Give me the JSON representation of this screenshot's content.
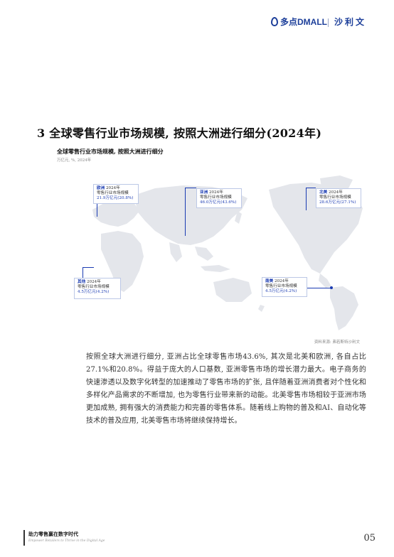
{
  "header": {
    "brand_dmall": "多点DMALL",
    "brand_shaliwen": "沙利文"
  },
  "section": {
    "title": "3  全球零售行业市场规模, 按照大洲进行细分(2024年)"
  },
  "chart": {
    "title": "全球零售行业市场规模, 按照大洲进行细分",
    "unit": "万亿元, %, 2024年",
    "source": "资料来源: 弗若斯特沙利文"
  },
  "chart_data": {
    "type": "map",
    "metric_label": "零售行业市场规模",
    "year": "2024年",
    "regions": [
      {
        "name": "欧洲",
        "value": 21.9,
        "share": 20.8,
        "value_text": "21.9万亿元(20.8%)"
      },
      {
        "name": "亚洲",
        "value": 46.0,
        "share": 43.6,
        "value_text": "46.0万亿元(43.6%)"
      },
      {
        "name": "北美",
        "value": 28.6,
        "share": 27.1,
        "value_text": "28.6万亿元(27.1%)"
      },
      {
        "name": "南美",
        "value": 4.5,
        "share": 4.2,
        "value_text": "4.5万亿元(4.2%)"
      },
      {
        "name": "其他",
        "value": 4.5,
        "share": 4.2,
        "value_text": "4.5万亿元(4.2%)"
      }
    ]
  },
  "body": {
    "paragraph": "按照全球大洲进行细分, 亚洲占比全球零售市场43.6%, 其次是北美和欧洲, 各自占比27.1%和20.8%。得益于庞大的人口基数, 亚洲零售市场的增长潜力最大。电子商务的快速渗透以及数字化转型的加速推动了零售市场的扩张, 且伴随着亚洲消费者对个性化和多样化产品需求的不断增加, 也为零售行业带来新的动能。北美零售市场相较于亚洲市场更加成熟, 拥有强大的消费能力和完善的零售体系。随着线上购物的普及和AI、自动化等技术的普及应用, 北美零售市场将继续保持增长。"
  },
  "footer": {
    "title": "助力零售赢在数字时代",
    "subtitle": "Empower Retailers to Thrive in the Digital Age",
    "page_number": "05"
  },
  "icons": [
    "dmall-drop-logo",
    "world-map"
  ]
}
